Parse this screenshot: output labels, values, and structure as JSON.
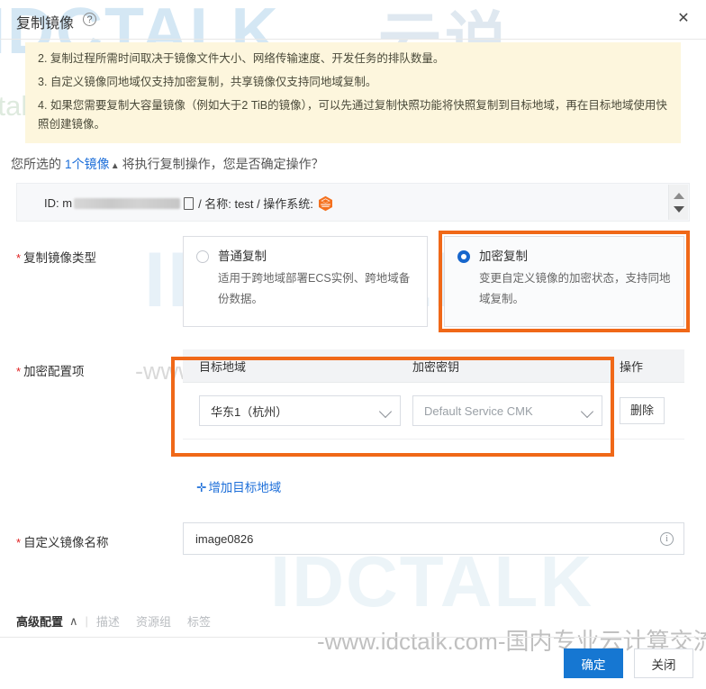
{
  "dialog": {
    "title": "复制镜像",
    "help_icon": "question-mark-icon",
    "close_label": "✕"
  },
  "notice": {
    "items": [
      "2. 复制过程所需时间取决于镜像文件大小、网络传输速度、开发任务的排队数量。",
      "3. 自定义镜像同地域仅支持加密复制，共享镜像仅支持同地域复制。",
      "4. 如果您需要复制大容量镜像（例如大于2 TiB的镜像），可以先通过复制快照功能将快照复制到目标地域，再在目标地域使用快照创建镜像。"
    ]
  },
  "selection": {
    "prefix": "您所选的",
    "count_label": "1个镜像",
    "caret": "▲",
    "suffix": "将执行复制操作，您是否确定操作？",
    "row": {
      "id_label": "ID: m",
      "id_masked": "",
      "name_label": "/ 名称: test / 操作系统:",
      "os_icon": "anolis-os-icon"
    }
  },
  "copy_type": {
    "label": "复制镜像类型",
    "required": "*",
    "options": [
      {
        "title": "普通复制",
        "desc": "适用于跨地域部署ECS实例、跨地域备份数据。",
        "selected": false
      },
      {
        "title": "加密复制",
        "desc": "变更自定义镜像的加密状态，支持同地域复制。",
        "selected": true
      }
    ]
  },
  "encryption": {
    "label": "加密配置项",
    "required": "*",
    "columns": {
      "region": "目标地域",
      "key": "加密密钥",
      "action": "操作"
    },
    "rows": [
      {
        "region_value": "华东1（杭州）",
        "key_value": "Default Service CMK",
        "delete_label": "删除"
      }
    ],
    "add_label": "增加目标地域",
    "add_plus": "✛"
  },
  "image_name": {
    "label": "自定义镜像名称",
    "required": "*",
    "value": "image0826",
    "info_icon": "info-icon"
  },
  "advanced": {
    "title": "高级配置",
    "caret": "∧",
    "divider": "|",
    "links": [
      "描述",
      "资源组",
      "标签"
    ]
  },
  "footer": {
    "confirm_label": "确定",
    "close_label": "关闭"
  },
  "watermarks": {
    "brand_big": "IDCTALK",
    "brand_cn": "云说",
    "url_line_1": "ctalk.com-国内专业云计算交流服务平台-",
    "url_line_2": "-www.idctalk.com-国内专业云计算交流服务平台-",
    "url_line_3": "-www.idctalk.com-国内专业云计算交流"
  },
  "colors": {
    "accent_blue": "#1677d2",
    "highlight_orange": "#f06818",
    "notice_bg": "#fdf6dd",
    "required_red": "#e02020"
  }
}
